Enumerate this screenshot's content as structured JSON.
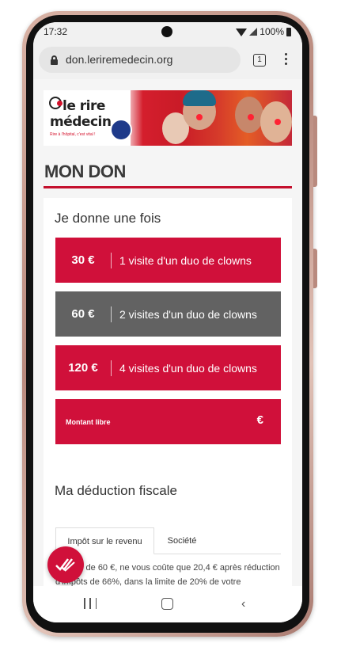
{
  "status_bar": {
    "time": "17:32",
    "battery": "100%"
  },
  "browser": {
    "url": "don.leriremedecin.org",
    "tab_count": "1"
  },
  "banner": {
    "logo_line1": "le rire",
    "logo_line2": "médecin",
    "logo_tagline": "Rire à l'hôpital, c'est vital !"
  },
  "page": {
    "title": "MON DON",
    "once_heading": "Je donne une fois",
    "amounts": [
      {
        "amount": "30 €",
        "description": "1 visite d'un duo de clowns",
        "selected": false
      },
      {
        "amount": "60 €",
        "description": "2 visites d'un duo de clowns",
        "selected": true
      },
      {
        "amount": "120 €",
        "description": "4 visites d'un duo de clowns",
        "selected": false
      }
    ],
    "free_amount": {
      "label": "Montant libre",
      "currency": "€"
    },
    "fiscal_title": "Ma déduction fiscale",
    "tabs": [
      "Impôt sur le revenu",
      "Société"
    ],
    "fiscal_text": "Un don de 60 €, ne vous coûte que 20,4 € après réduction d'impôts de 66%, dans la limite de 20% de votre"
  },
  "colors": {
    "accent": "#d0103a",
    "selected": "#626262"
  }
}
